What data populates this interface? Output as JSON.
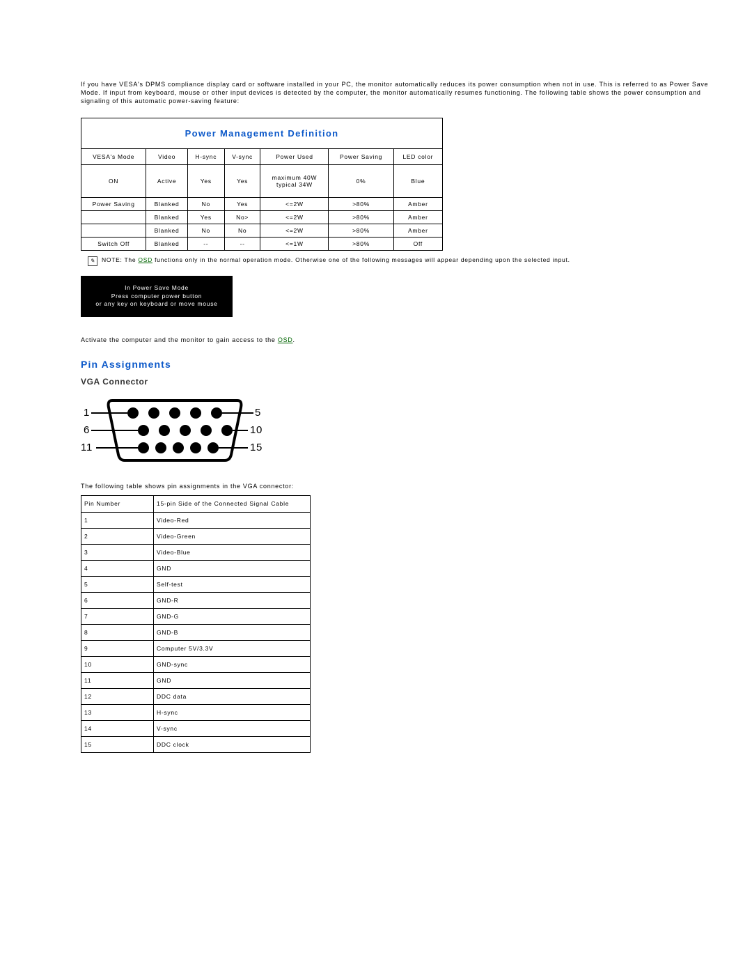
{
  "intro": "If you have VESA's DPMS compliance display card or software installed in your PC, the monitor automatically reduces its power consumption when not in use. This is referred to as Power Save Mode. If input from keyboard, mouse or other input devices is detected by the computer, the monitor automatically resumes functioning. The following table shows the power consumption and signaling of this automatic power-saving feature:",
  "pm": {
    "title": "Power Management Definition",
    "headers": [
      "VESA's Mode",
      "Video",
      "H-sync",
      "V-sync",
      "Power Used",
      "Power Saving",
      "LED color"
    ],
    "rows": [
      [
        "ON",
        "Active",
        "Yes",
        "Yes",
        "maximum 40W\ntypical 34W",
        "0%",
        "Blue"
      ],
      [
        "Power Saving",
        "Blanked",
        "No",
        "Yes",
        "<=2W",
        ">80%",
        "Amber"
      ],
      [
        "",
        "Blanked",
        "Yes",
        "No>",
        "<=2W",
        ">80%",
        "Amber"
      ],
      [
        "",
        "Blanked",
        "No",
        "No",
        "<=2W",
        ">80%",
        "Amber"
      ],
      [
        "Switch Off",
        "Blanked",
        "--",
        "--",
        "<=1W",
        ">80%",
        "Off"
      ]
    ]
  },
  "note": {
    "prefix": "NOTE: The ",
    "link": "OSD",
    "suffix": " functions only in the normal operation mode. Otherwise one of the following messages will appear depending upon the selected input."
  },
  "blackbox": {
    "line1": "In Power Save Mode",
    "line2": "Press computer power button",
    "line3": "or any key on keyboard or move mouse"
  },
  "para2_prefix": "Activate the computer and the monitor to gain access to the ",
  "para2_link": "OSD",
  "para2_suffix": ".",
  "h_pin": "Pin Assignments",
  "h_vga": "VGA Connector",
  "vga_labels": {
    "l1": "1",
    "l6": "6",
    "l11": "11",
    "r5": "5",
    "r10": "10",
    "r15": "15"
  },
  "pin_intro": "The following table shows pin assignments in the VGA connector:",
  "pin": {
    "h1": "Pin Number",
    "h2": "15-pin Side of the Connected Signal Cable",
    "rows": [
      [
        "1",
        "Video-Red"
      ],
      [
        "2",
        "Video-Green"
      ],
      [
        "3",
        "Video-Blue"
      ],
      [
        "4",
        "GND"
      ],
      [
        "5",
        "Self-test"
      ],
      [
        "6",
        "GND-R"
      ],
      [
        "7",
        "GND-G"
      ],
      [
        "8",
        "GND-B"
      ],
      [
        "9",
        "Computer 5V/3.3V"
      ],
      [
        "10",
        "GND-sync"
      ],
      [
        "11",
        "GND"
      ],
      [
        "12",
        "DDC data"
      ],
      [
        "13",
        "H-sync"
      ],
      [
        "14",
        "V-sync"
      ],
      [
        "15",
        "DDC clock"
      ]
    ]
  }
}
